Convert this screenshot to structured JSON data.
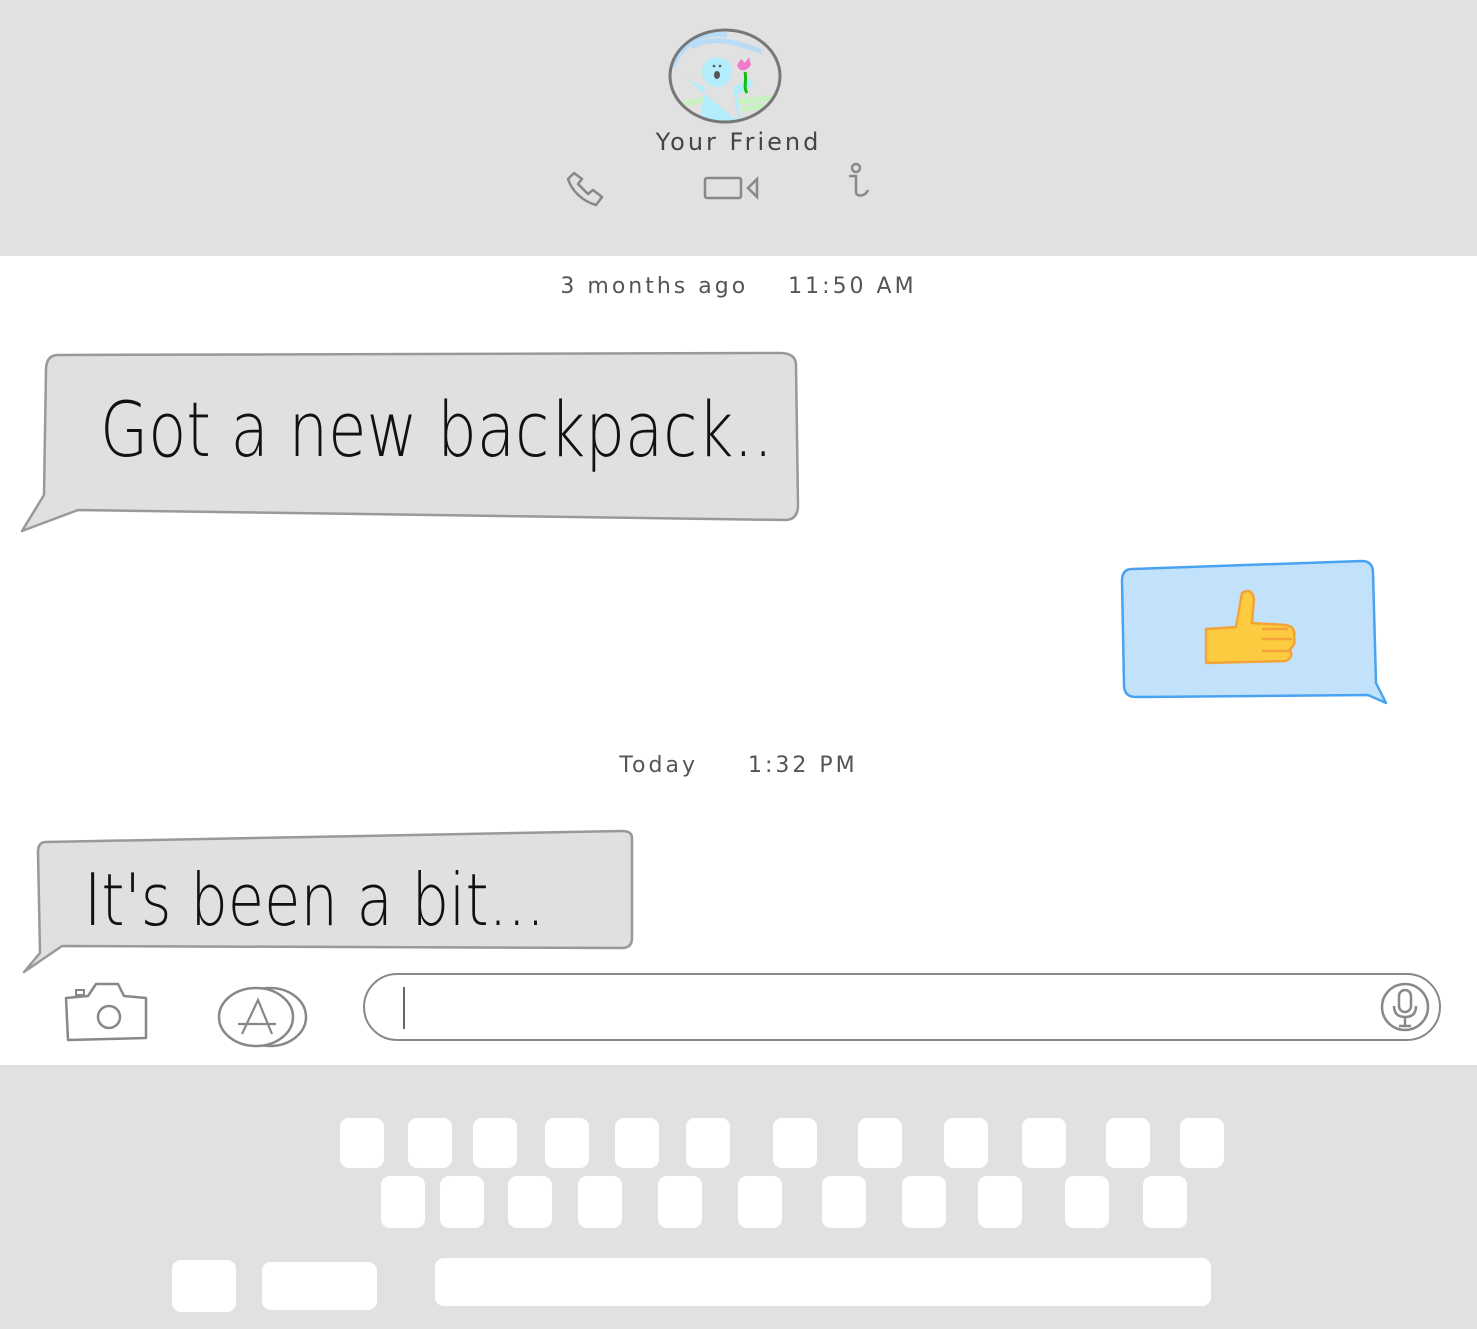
{
  "header": {
    "contact_name": "Your Friend",
    "actions": [
      "phone-icon",
      "video-icon",
      "info-icon"
    ]
  },
  "conversation": {
    "timestamps": [
      {
        "when": "3 months ago",
        "time": "11:50 AM"
      },
      {
        "when": "Today",
        "time": "1:32 PM"
      }
    ],
    "messages": [
      {
        "sender": "friend",
        "text": "Got a new backpack.."
      },
      {
        "sender": "me",
        "content": "thumbs-up-icon"
      },
      {
        "sender": "friend",
        "text": "It's been a bit..."
      }
    ]
  },
  "composer": {
    "value": "",
    "icons": [
      "camera-icon",
      "app-store-icon",
      "microphone-icon"
    ]
  },
  "colors": {
    "header_bg": "#e1e1e1",
    "incoming_bubble": "#e0e0e0",
    "outgoing_bubble": "#c2e2fb",
    "outgoing_border": "#4aa3f0"
  }
}
